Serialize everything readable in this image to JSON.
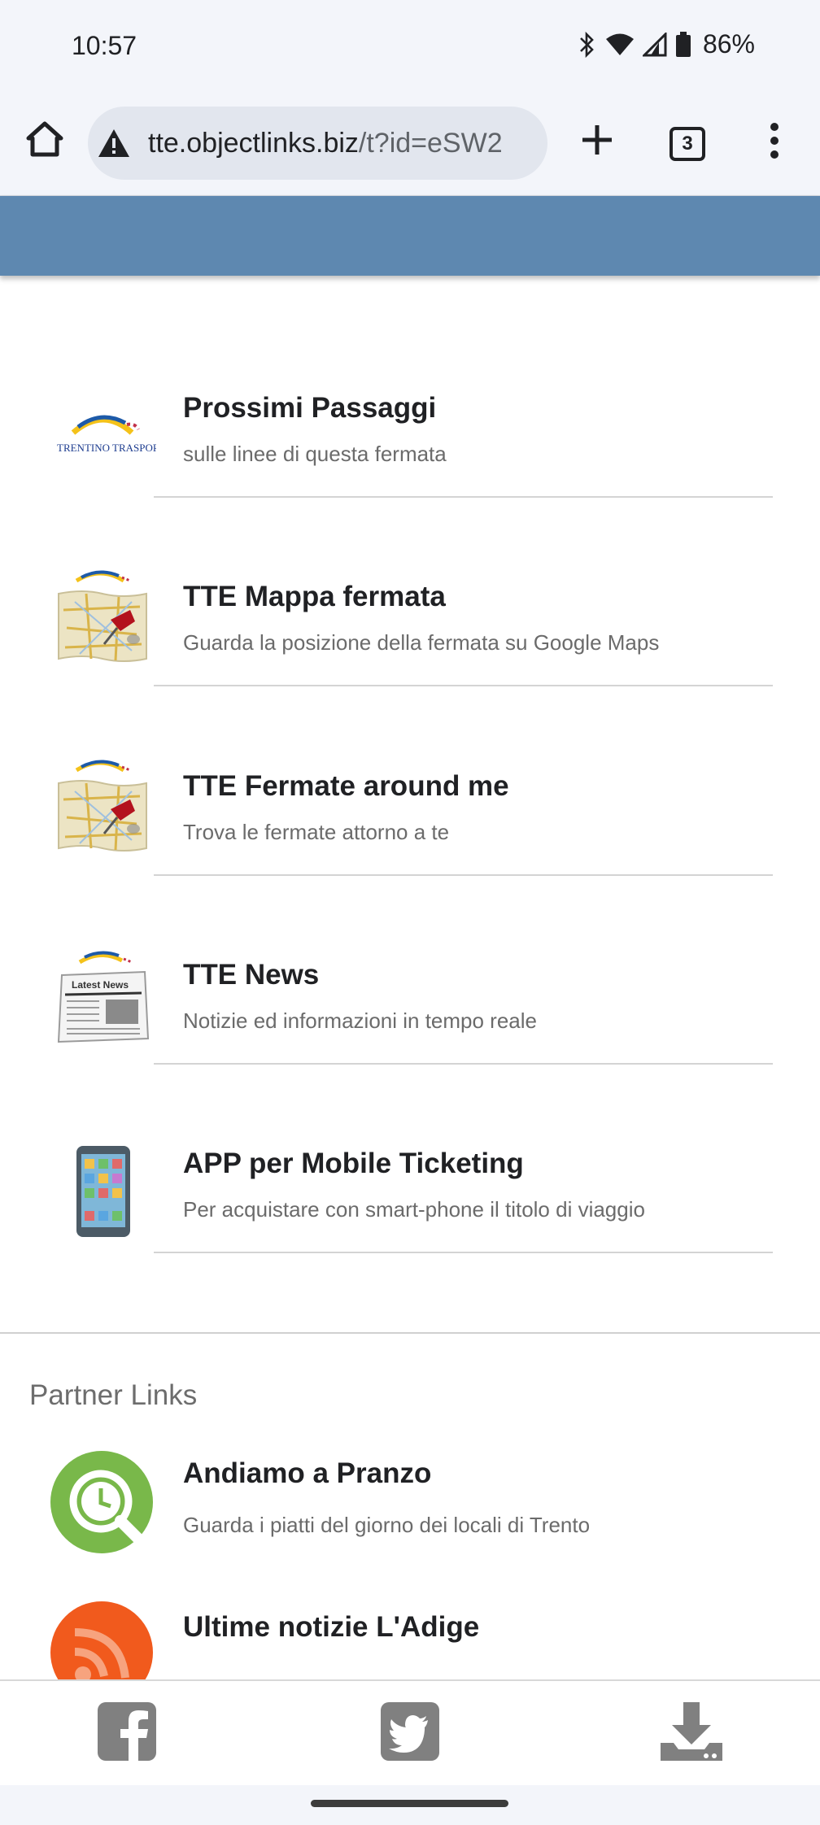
{
  "status": {
    "time": "10:57",
    "battery": "86%"
  },
  "browser": {
    "url_domain": "tte.objectlinks.biz",
    "url_path": "/t?id=eSW2",
    "tab_count": "3"
  },
  "main": {
    "items": [
      {
        "title": "Prossimi Passaggi",
        "subtitle": "sulle linee di questa fermata",
        "logo_text": "TRENTINO TRASPORTI",
        "icon": "trentino-trasporti-logo-icon"
      },
      {
        "title": "TTE Mappa fermata",
        "subtitle": "Guarda la posizione della fermata su Google Maps",
        "icon": "map-pin-icon"
      },
      {
        "title": "TTE Fermate around me",
        "subtitle": "Trova le fermate attorno a te",
        "icon": "map-pin-icon"
      },
      {
        "title": "TTE News",
        "subtitle": "Notizie ed informazioni in tempo reale",
        "logo_text": "Latest News",
        "icon": "newspaper-icon"
      },
      {
        "title": "APP per Mobile Ticketing",
        "subtitle": "Per acquistare con smart-phone il titolo di viaggio",
        "icon": "smartphone-icon"
      }
    ]
  },
  "partners": {
    "heading": "Partner Links",
    "items": [
      {
        "title": "Andiamo a Pranzo",
        "subtitle": "Guarda i piatti del giorno dei locali di Trento",
        "icon": "clock-search-icon",
        "color": "#79b84a"
      },
      {
        "title": "Ultime notizie L'Adige",
        "subtitle": "",
        "icon": "rss-icon",
        "color": "#f15a1d"
      }
    ]
  },
  "share_bar": {
    "icons": [
      "facebook-icon",
      "twitter-icon",
      "download-icon"
    ],
    "color": "#808080"
  },
  "colors": {
    "header_band": "#5e88b0",
    "chrome_bg": "#f3f5fa"
  }
}
